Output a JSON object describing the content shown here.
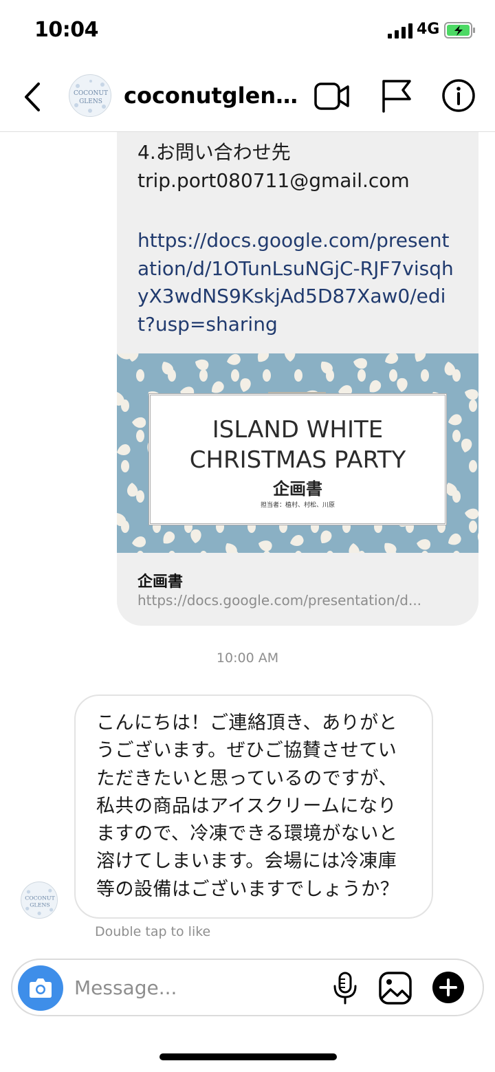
{
  "status_bar": {
    "time": "10:04",
    "network": "4G",
    "battery_state": "charging",
    "battery_color": "#4cd964"
  },
  "header": {
    "username": "coconutglens_...",
    "avatar_text_top": "COCONUT",
    "avatar_text_bottom": "GLENS",
    "icons": [
      "back-icon",
      "video-call-icon",
      "flag-icon",
      "info-icon"
    ]
  },
  "shared_message": {
    "heading": "4.お問い合わせ先",
    "email": "trip.port080711@gmail.com",
    "link": "https://docs.google.com/presentation/d/1OTunLsuNGjC-RJF7visqhyX3wdNS9KskjAd5D87Xaw0/edit?usp=sharing",
    "preview": {
      "title_line1": "ISLAND WHITE",
      "title_line2": "CHRISTMAS PARTY",
      "subtitle": "企画書",
      "names": "担当者：植村、村松、川原",
      "bg_color": "#8ab0c4"
    },
    "link_title": "企画書",
    "link_url": "https://docs.google.com/presentation/d..."
  },
  "timestamp": "10:00 AM",
  "reply": {
    "text": "こんにちは！ご連絡頂き、ありがとうございます。ぜひご協賛させていただきたいと思っているのですが、私共の商品はアイスクリームになりますので、冷凍できる環境がないと溶けてしまいます。会場には冷凍庫等の設備はございますでしょうか？",
    "hint": "Double tap to like"
  },
  "composer": {
    "placeholder": "Message...",
    "value": "",
    "accent_color": "#3e8ee9",
    "icons": [
      "camera-icon",
      "microphone-icon",
      "gallery-icon",
      "plus-icon"
    ]
  }
}
